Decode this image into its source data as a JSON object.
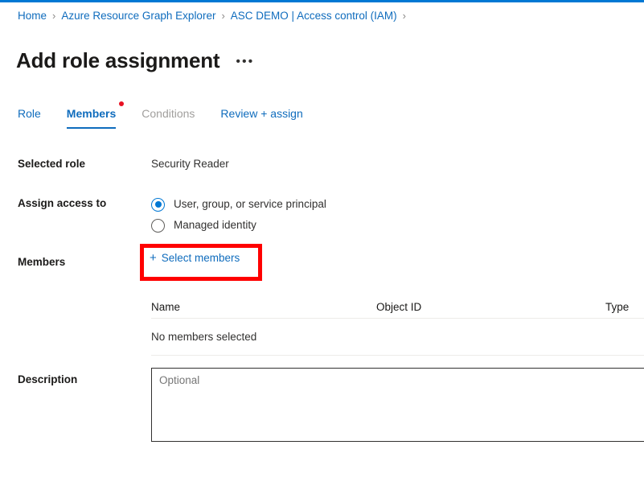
{
  "theme": {
    "accent": "#0078d4",
    "link": "#0f6cbd",
    "highlight": "#ff0000",
    "badge": "#e81123",
    "disabled_text": "#a19f9d"
  },
  "breadcrumb": {
    "separator": "›",
    "items": [
      {
        "label": "Home"
      },
      {
        "label": "Azure Resource Graph Explorer"
      },
      {
        "label": "ASC DEMO | Access control (IAM)"
      }
    ]
  },
  "header": {
    "title": "Add role assignment",
    "more_commands": "•••"
  },
  "tabs": [
    {
      "label": "Role",
      "state": "enabled"
    },
    {
      "label": "Members",
      "state": "selected",
      "badge": true
    },
    {
      "label": "Conditions",
      "state": "disabled"
    },
    {
      "label": "Review + assign",
      "state": "enabled"
    }
  ],
  "form": {
    "selected_role": {
      "label": "Selected role",
      "value": "Security Reader"
    },
    "assign_access_to": {
      "label": "Assign access to",
      "options": [
        {
          "label": "User, group, or service principal",
          "checked": true
        },
        {
          "label": "Managed identity",
          "checked": false
        }
      ]
    },
    "members": {
      "label": "Members",
      "select_button": {
        "icon": "plus-icon",
        "plus": "+",
        "label": "Select members"
      },
      "table": {
        "columns": [
          "Name",
          "Object ID",
          "Type"
        ],
        "empty_message": "No members selected",
        "rows": []
      }
    },
    "description": {
      "label": "Description",
      "value": "",
      "placeholder": "Optional"
    }
  }
}
